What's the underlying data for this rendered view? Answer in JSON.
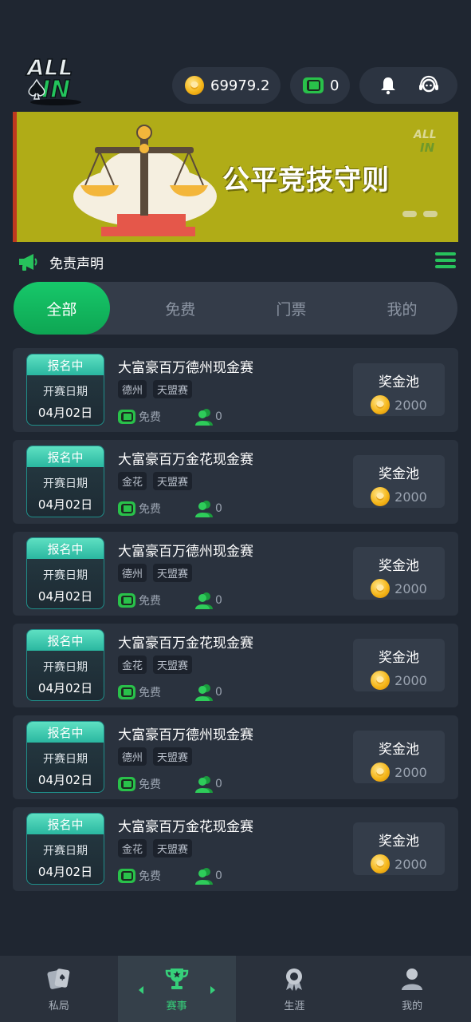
{
  "header": {
    "coins": "69979.2",
    "tickets": "0"
  },
  "banner": {
    "title": "公平竞技守则"
  },
  "notice": {
    "text": "免责声明"
  },
  "tabs": [
    {
      "label": "全部"
    },
    {
      "label": "免费"
    },
    {
      "label": "门票"
    },
    {
      "label": "我的"
    }
  ],
  "tournaments": [
    {
      "status": "报名中",
      "date_label": "开赛日期",
      "date": "04月02日",
      "title": "大富豪百万德州现金赛",
      "tags": [
        "德州",
        "天盟赛"
      ],
      "fee": "免费",
      "players": "0",
      "prize_label": "奖金池",
      "prize": "2000"
    },
    {
      "status": "报名中",
      "date_label": "开赛日期",
      "date": "04月02日",
      "title": "大富豪百万金花现金赛",
      "tags": [
        "金花",
        "天盟赛"
      ],
      "fee": "免费",
      "players": "0",
      "prize_label": "奖金池",
      "prize": "2000"
    },
    {
      "status": "报名中",
      "date_label": "开赛日期",
      "date": "04月02日",
      "title": "大富豪百万德州现金赛",
      "tags": [
        "德州",
        "天盟赛"
      ],
      "fee": "免费",
      "players": "0",
      "prize_label": "奖金池",
      "prize": "2000"
    },
    {
      "status": "报名中",
      "date_label": "开赛日期",
      "date": "04月02日",
      "title": "大富豪百万金花现金赛",
      "tags": [
        "金花",
        "天盟赛"
      ],
      "fee": "免费",
      "players": "0",
      "prize_label": "奖金池",
      "prize": "2000"
    },
    {
      "status": "报名中",
      "date_label": "开赛日期",
      "date": "04月02日",
      "title": "大富豪百万德州现金赛",
      "tags": [
        "德州",
        "天盟赛"
      ],
      "fee": "免费",
      "players": "0",
      "prize_label": "奖金池",
      "prize": "2000"
    },
    {
      "status": "报名中",
      "date_label": "开赛日期",
      "date": "04月02日",
      "title": "大富豪百万金花现金赛",
      "tags": [
        "金花",
        "天盟赛"
      ],
      "fee": "免费",
      "players": "0",
      "prize_label": "奖金池",
      "prize": "2000"
    }
  ],
  "bottom_nav": [
    {
      "label": "私局",
      "icon": "cards-icon"
    },
    {
      "label": "赛事",
      "icon": "trophy-icon"
    },
    {
      "label": "生涯",
      "icon": "medal-icon"
    },
    {
      "label": "我的",
      "icon": "user-icon"
    }
  ],
  "colors": {
    "background": "#1f2631",
    "accent_green": "#17c86a",
    "banner": "#b0ac17",
    "status_teal": "#2ab7a0"
  }
}
